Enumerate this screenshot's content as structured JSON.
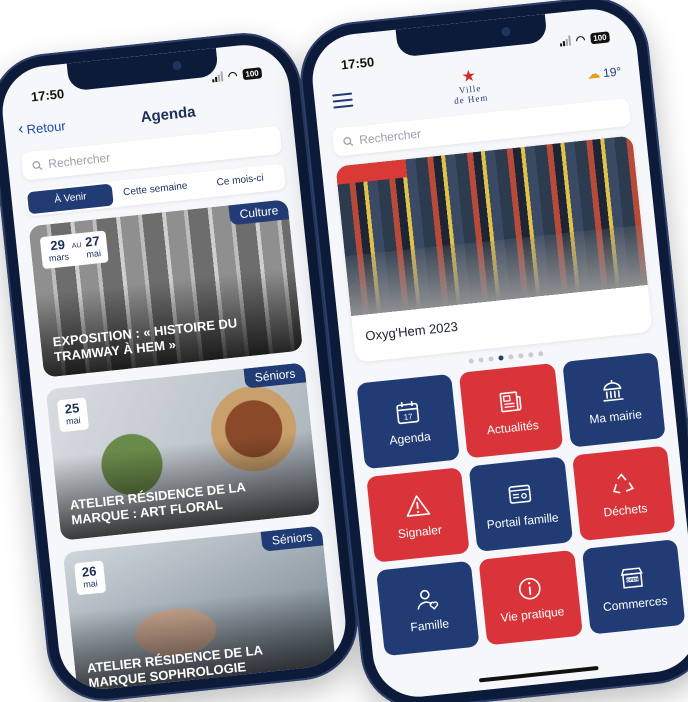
{
  "left_phone": {
    "status_time": "17:50",
    "battery": "100",
    "back_label": "Retour",
    "title": "Agenda",
    "search_placeholder": "Rechercher",
    "tabs": [
      {
        "label": "À Venir",
        "active": true
      },
      {
        "label": "Cette semaine",
        "active": false
      },
      {
        "label": "Ce mois-ci",
        "active": false
      }
    ],
    "events": [
      {
        "day_start": "29",
        "month_start": "mars",
        "separator": "AU",
        "day_end": "27",
        "month_end": "mai",
        "category": "Culture",
        "title": "Exposition : « Histoire du tramway à Hem »"
      },
      {
        "day_start": "25",
        "month_start": "mai",
        "category": "Séniors",
        "title": "Atelier résidence de la Marque : art floral"
      },
      {
        "day_start": "26",
        "month_start": "mai",
        "category": "Séniors",
        "title": "Atelier résidence de la Marque sophrologie"
      }
    ]
  },
  "right_phone": {
    "status_time": "17:50",
    "battery": "100",
    "logo": {
      "line1": "Ville",
      "line2": "de Hem"
    },
    "weather": "19°",
    "search_placeholder": "Rechercher",
    "carousel": {
      "caption": "Oxyg'Hem 2023",
      "dots": 8,
      "active_dot": 3
    },
    "tiles": [
      {
        "label": "Agenda",
        "color": "#213c74",
        "icon": "calendar-icon",
        "calendar_day": "17"
      },
      {
        "label": "Actualités",
        "color": "#d8343a",
        "icon": "newspaper-icon"
      },
      {
        "label": "Ma mairie",
        "color": "#213c74",
        "icon": "town-hall-icon"
      },
      {
        "label": "Signaler",
        "color": "#d8343a",
        "icon": "warning-icon"
      },
      {
        "label": "Portail famille",
        "color": "#213c74",
        "icon": "portal-icon"
      },
      {
        "label": "Déchets",
        "color": "#d8343a",
        "icon": "recycle-icon"
      },
      {
        "label": "Famille",
        "color": "#213c74",
        "icon": "family-icon"
      },
      {
        "label": "Vie pratique",
        "color": "#d8343a",
        "icon": "info-icon"
      },
      {
        "label": "Commerces",
        "color": "#213c74",
        "icon": "shop-icon",
        "sign_text": "OPEN"
      }
    ]
  },
  "colors": {
    "navy": "#213c74",
    "red": "#d8343a",
    "frame": "#0d1b3a"
  }
}
